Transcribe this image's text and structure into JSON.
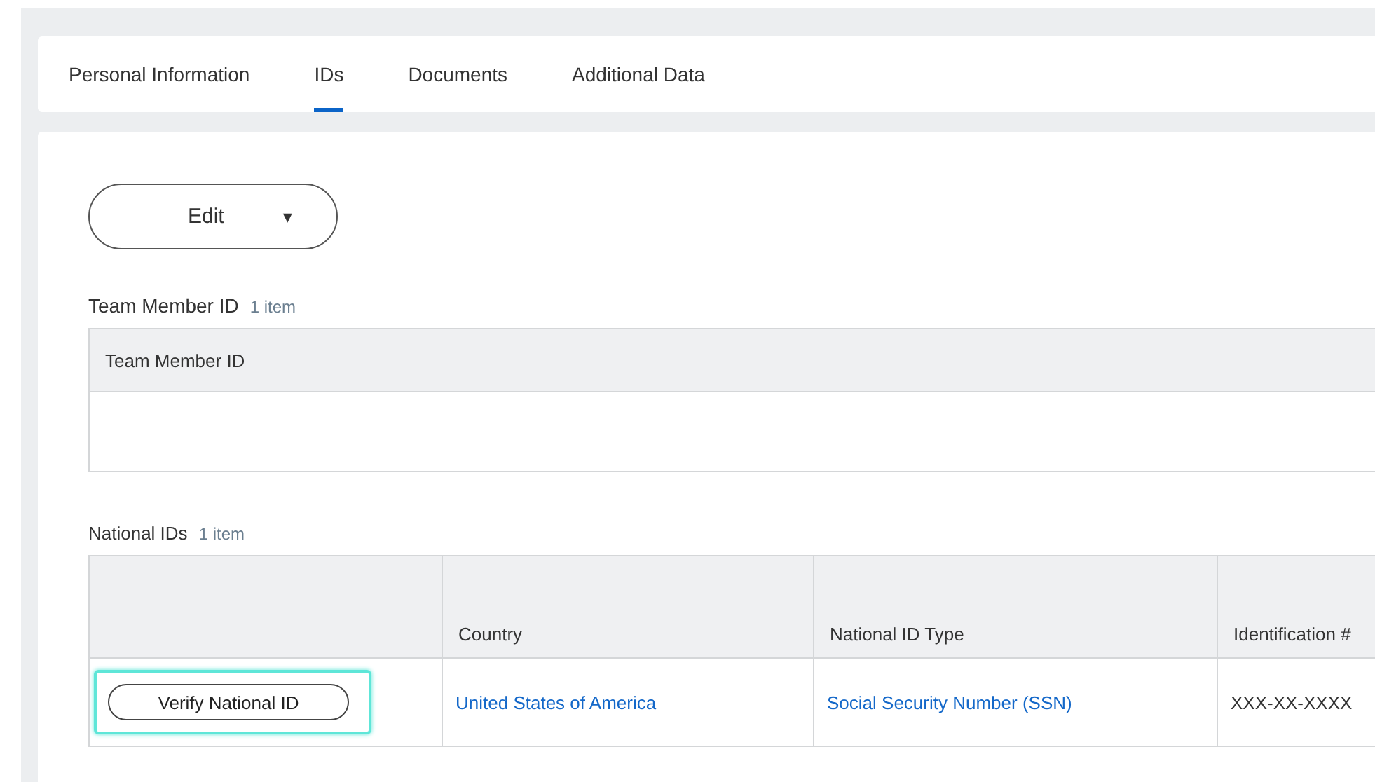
{
  "tabs": [
    {
      "label": "Personal Information",
      "selected": false
    },
    {
      "label": "IDs",
      "selected": true
    },
    {
      "label": "Documents",
      "selected": false
    },
    {
      "label": "Additional Data",
      "selected": false
    }
  ],
  "edit_button": {
    "label": "Edit",
    "caret": "▾"
  },
  "team_member_section": {
    "title": "Team Member ID",
    "count": "1 item",
    "columns": [
      "Team Member ID"
    ]
  },
  "national_ids_section": {
    "title": "National IDs",
    "count": "1 item",
    "columns": [
      "",
      "Country",
      "National ID Type",
      "Identification #"
    ],
    "rows": [
      {
        "action": {
          "label": "Verify National ID",
          "highlighted": true
        },
        "country": "United States of America",
        "id_type": "Social Security Number (SSN)",
        "identification": "XXX-XX-XXXX"
      }
    ]
  }
}
